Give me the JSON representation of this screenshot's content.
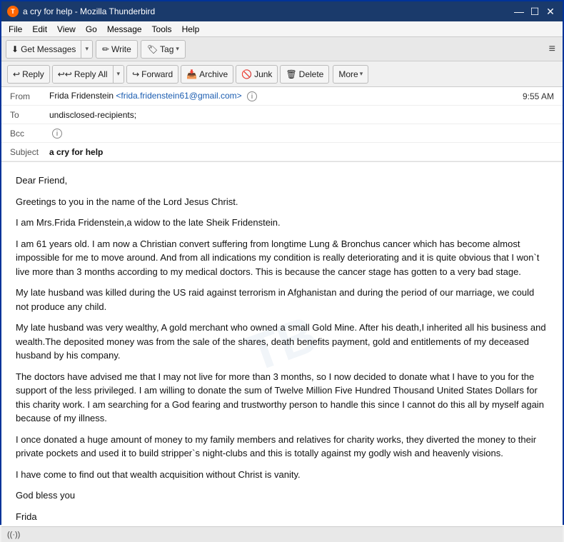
{
  "window": {
    "title": "a cry for help - Mozilla Thunderbird",
    "icon": "T"
  },
  "titlebar": {
    "minimize": "—",
    "maximize": "☐",
    "close": "✕"
  },
  "menubar": {
    "items": [
      "File",
      "Edit",
      "View",
      "Go",
      "Message",
      "Tools",
      "Help"
    ]
  },
  "toolbar": {
    "get_messages_label": "Get Messages",
    "write_label": "Write",
    "tag_label": "Tag",
    "hamburger": "≡"
  },
  "email_toolbar": {
    "reply_label": "Reply",
    "reply_all_label": "Reply All",
    "forward_label": "Forward",
    "archive_label": "Archive",
    "junk_label": "Junk",
    "delete_label": "Delete",
    "more_label": "More"
  },
  "email_header": {
    "from_label": "From",
    "from_name": "Frida Fridenstein",
    "from_email": "<frida.fridenstein61@gmail.com>",
    "to_label": "To",
    "to_value": "undisclosed-recipients;",
    "bcc_label": "Bcc",
    "time": "9:55 AM",
    "subject_label": "Subject",
    "subject_value": "a cry for help"
  },
  "email_body": {
    "greeting": "Dear Friend,",
    "para1": "Greetings to you in the name of the Lord Jesus Christ.",
    "para2": "I am Mrs.Frida Fridenstein,a widow to the late Sheik Fridenstein.",
    "para3": "I am 61 years old. I am now a Christian convert suffering from longtime Lung & Bronchus cancer which has become almost impossible for me to move around. And from all indications my condition is really deteriorating and it is quite obvious that I won`t live more than 3 months according to my medical doctors. This is because the cancer stage has gotten to a very bad stage.",
    "para4": "My late husband was killed during the US raid against terrorism in Afghanistan and during the period of our marriage, we could not produce any child.",
    "para5": "My late husband was very wealthy, A gold merchant who owned a small Gold Mine. After his death,I inherited all his business and wealth.The deposited money was from the sale of the shares, death benefits payment, gold and entitlements of my deceased husband by his company.",
    "para6": "The doctors have advised me that I may not live for more than 3 months, so I now decided to donate what I have to you for the support of the less privileged. I am willing to donate the sum of Twelve Million Five Hundred Thousand United States Dollars for this charity work. I am searching for a God fearing and trustworthy person to handle this since I cannot do this all by myself again because of my illness.",
    "para7": "I once donated a huge amount of money to my family members and relatives for charity works, they diverted the money to their private pockets and used it to build stripper`s night-clubs and this is totally against my godly wish and heavenly visions.",
    "para8": "I have come to find out that wealth acquisition without Christ is vanity.",
    "para9": "God bless you",
    "para10": "Frida"
  },
  "statusbar": {
    "connection": "((·))"
  }
}
